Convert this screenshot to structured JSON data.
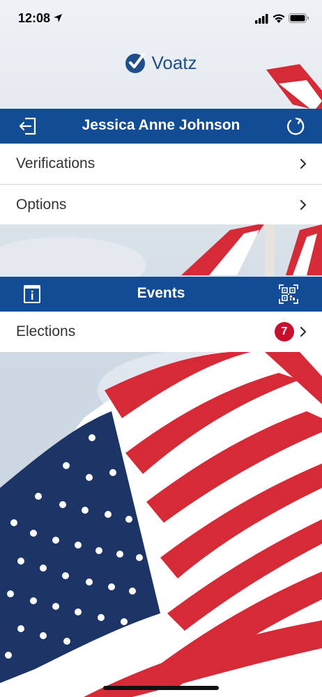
{
  "status_bar": {
    "time": "12:08"
  },
  "logo": {
    "text": "Voatz"
  },
  "user_header": {
    "title": "Jessica Anne Johnson"
  },
  "account_menu": {
    "items": [
      {
        "label": "Verifications"
      },
      {
        "label": "Options"
      }
    ]
  },
  "events_header": {
    "title": "Events"
  },
  "events_menu": {
    "items": [
      {
        "label": "Elections",
        "badge": "7"
      }
    ]
  },
  "colors": {
    "brand_blue": "#124c95",
    "badge_red": "#c8102e",
    "logo_blue": "#1f4e8c"
  },
  "icons": {
    "logout": "logout-icon",
    "refresh": "refresh-icon",
    "info": "info-icon",
    "qr": "qr-code-icon",
    "chevron": "chevron-right-icon"
  }
}
